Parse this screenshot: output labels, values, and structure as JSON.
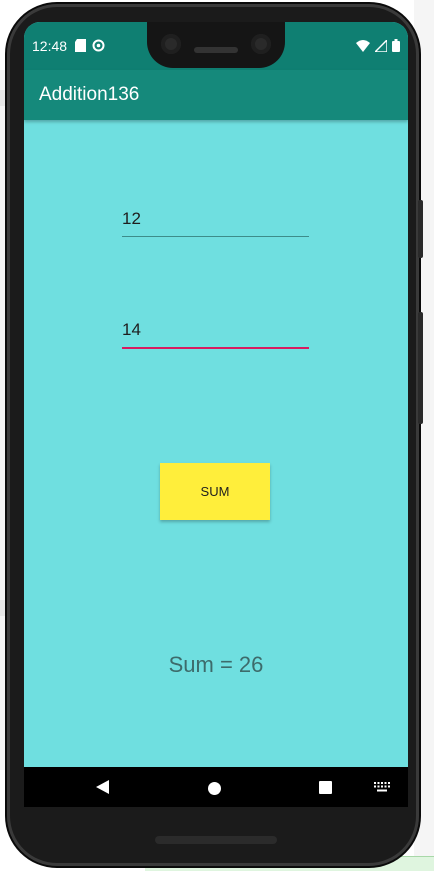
{
  "status_bar": {
    "time": "12:48",
    "left_icons": [
      "sd-card-icon",
      "data-saver-icon"
    ],
    "right_icons": [
      "wifi-icon",
      "signal-icon",
      "battery-icon"
    ]
  },
  "app_bar": {
    "title": "Addition136"
  },
  "form": {
    "first_number": "12",
    "second_number": "14",
    "sum_button_label": "SUM"
  },
  "result": {
    "text": "Sum = 26"
  },
  "nav_bar": {
    "icons": [
      "back-icon",
      "home-icon",
      "recents-icon",
      "keyboard-icon"
    ]
  },
  "colors": {
    "status_bar": "#0f7f72",
    "app_bar": "#15897b",
    "background": "#6fdfe0",
    "button": "#ffee3b",
    "focused_underline": "#d81b60"
  }
}
